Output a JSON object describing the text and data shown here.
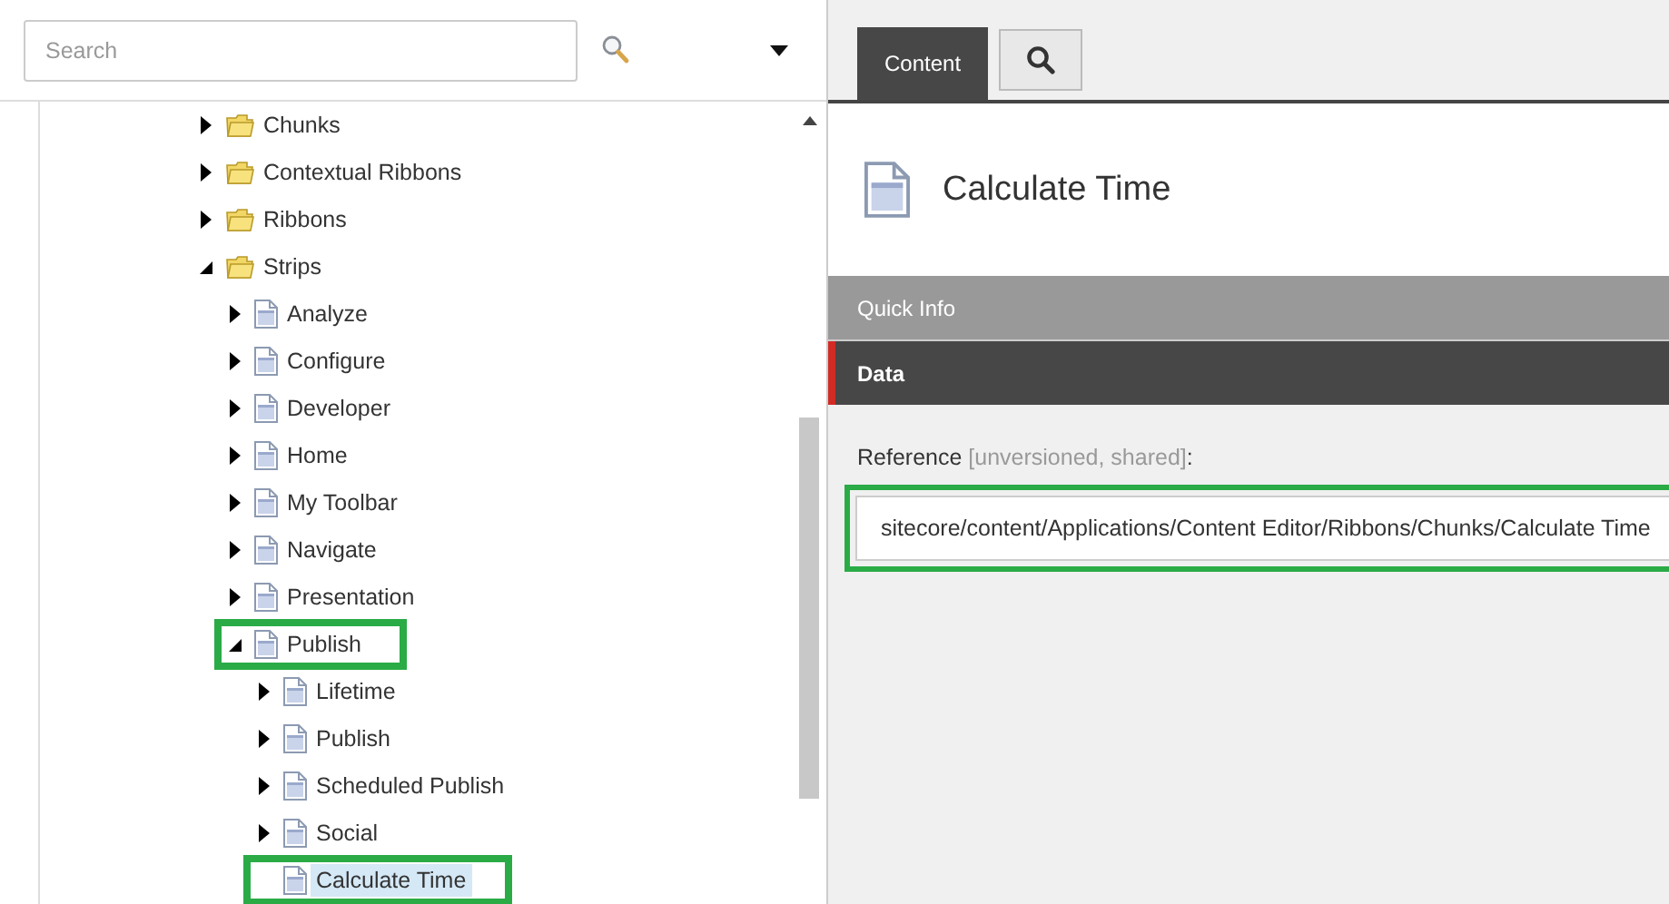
{
  "search": {
    "placeholder": "Search"
  },
  "tree": [
    {
      "label": "Chunks",
      "kind": "folder",
      "leaf": false,
      "expanded": false,
      "selected": false,
      "highlighted": false
    },
    {
      "label": "Contextual Ribbons",
      "kind": "folder",
      "leaf": false,
      "expanded": false,
      "selected": false,
      "highlighted": false
    },
    {
      "label": "Ribbons",
      "kind": "folder",
      "leaf": false,
      "expanded": false,
      "selected": false,
      "highlighted": false
    },
    {
      "label": "Strips",
      "kind": "folder",
      "leaf": false,
      "expanded": true,
      "selected": false,
      "highlighted": false,
      "children": [
        {
          "label": "Analyze",
          "kind": "document",
          "leaf": false,
          "expanded": false,
          "selected": false,
          "highlighted": false
        },
        {
          "label": "Configure",
          "kind": "document",
          "leaf": false,
          "expanded": false,
          "selected": false,
          "highlighted": false
        },
        {
          "label": "Developer",
          "kind": "document",
          "leaf": false,
          "expanded": false,
          "selected": false,
          "highlighted": false
        },
        {
          "label": "Home",
          "kind": "document",
          "leaf": false,
          "expanded": false,
          "selected": false,
          "highlighted": false
        },
        {
          "label": "My Toolbar",
          "kind": "document",
          "leaf": false,
          "expanded": false,
          "selected": false,
          "highlighted": false
        },
        {
          "label": "Navigate",
          "kind": "document",
          "leaf": false,
          "expanded": false,
          "selected": false,
          "highlighted": false
        },
        {
          "label": "Presentation",
          "kind": "document",
          "leaf": false,
          "expanded": false,
          "selected": false,
          "highlighted": false
        },
        {
          "label": "Publish",
          "kind": "document",
          "leaf": false,
          "expanded": true,
          "selected": false,
          "highlighted": true,
          "children": [
            {
              "label": "Lifetime",
              "kind": "document",
              "leaf": false,
              "expanded": false,
              "selected": false,
              "highlighted": false
            },
            {
              "label": "Publish",
              "kind": "document",
              "leaf": false,
              "expanded": false,
              "selected": false,
              "highlighted": false
            },
            {
              "label": "Scheduled Publish",
              "kind": "document",
              "leaf": false,
              "expanded": false,
              "selected": false,
              "highlighted": false
            },
            {
              "label": "Social",
              "kind": "document",
              "leaf": false,
              "expanded": false,
              "selected": false,
              "highlighted": false
            },
            {
              "label": "Calculate Time",
              "kind": "document",
              "leaf": true,
              "selected": true,
              "highlighted": true
            }
          ]
        }
      ]
    }
  ],
  "tabs": [
    {
      "kind": "text",
      "label": "Content",
      "selected": true
    },
    {
      "kind": "search",
      "selected": false
    }
  ],
  "item": {
    "title": "Calculate Time"
  },
  "sections": [
    {
      "label": "Quick Info",
      "expanded": false
    },
    {
      "label": "Data",
      "expanded": true
    }
  ],
  "field": {
    "label": "Reference",
    "note": "[unversioned, shared]",
    "suffix": ":",
    "value": "sitecore/content/Applications/Content Editor/Ribbons/Chunks/Calculate Time",
    "highlighted": true
  }
}
